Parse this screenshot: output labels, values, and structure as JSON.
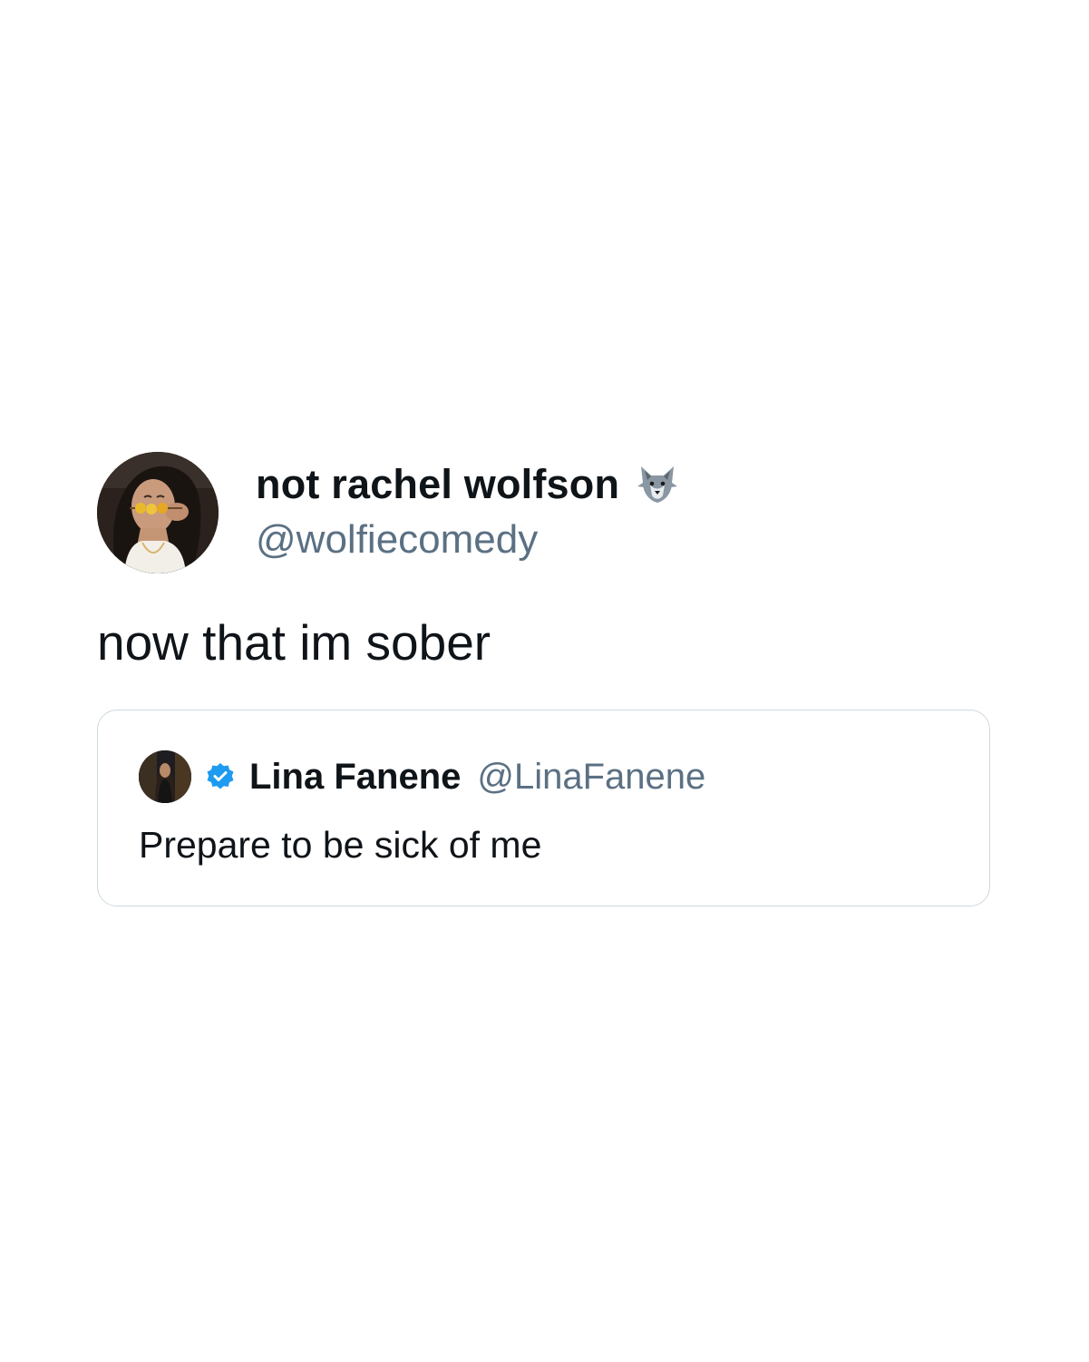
{
  "tweet": {
    "author": {
      "display_name": "not rachel wolfson",
      "handle": "@wolfiecomedy",
      "name_emoji": "wolf-icon",
      "avatar": "profile-photo"
    },
    "text": "now that im sober",
    "quoted_tweet": {
      "author": {
        "display_name": "Lina Fanene",
        "handle": "@LinaFanene",
        "verified": true,
        "avatar": "profile-photo"
      },
      "text": "Prepare to be sick of me"
    }
  },
  "colors": {
    "text_primary": "#0f1419",
    "text_secondary": "#5b7083",
    "verified_blue": "#1d9bf0",
    "border": "#cfd9de",
    "background": "#ffffff"
  }
}
